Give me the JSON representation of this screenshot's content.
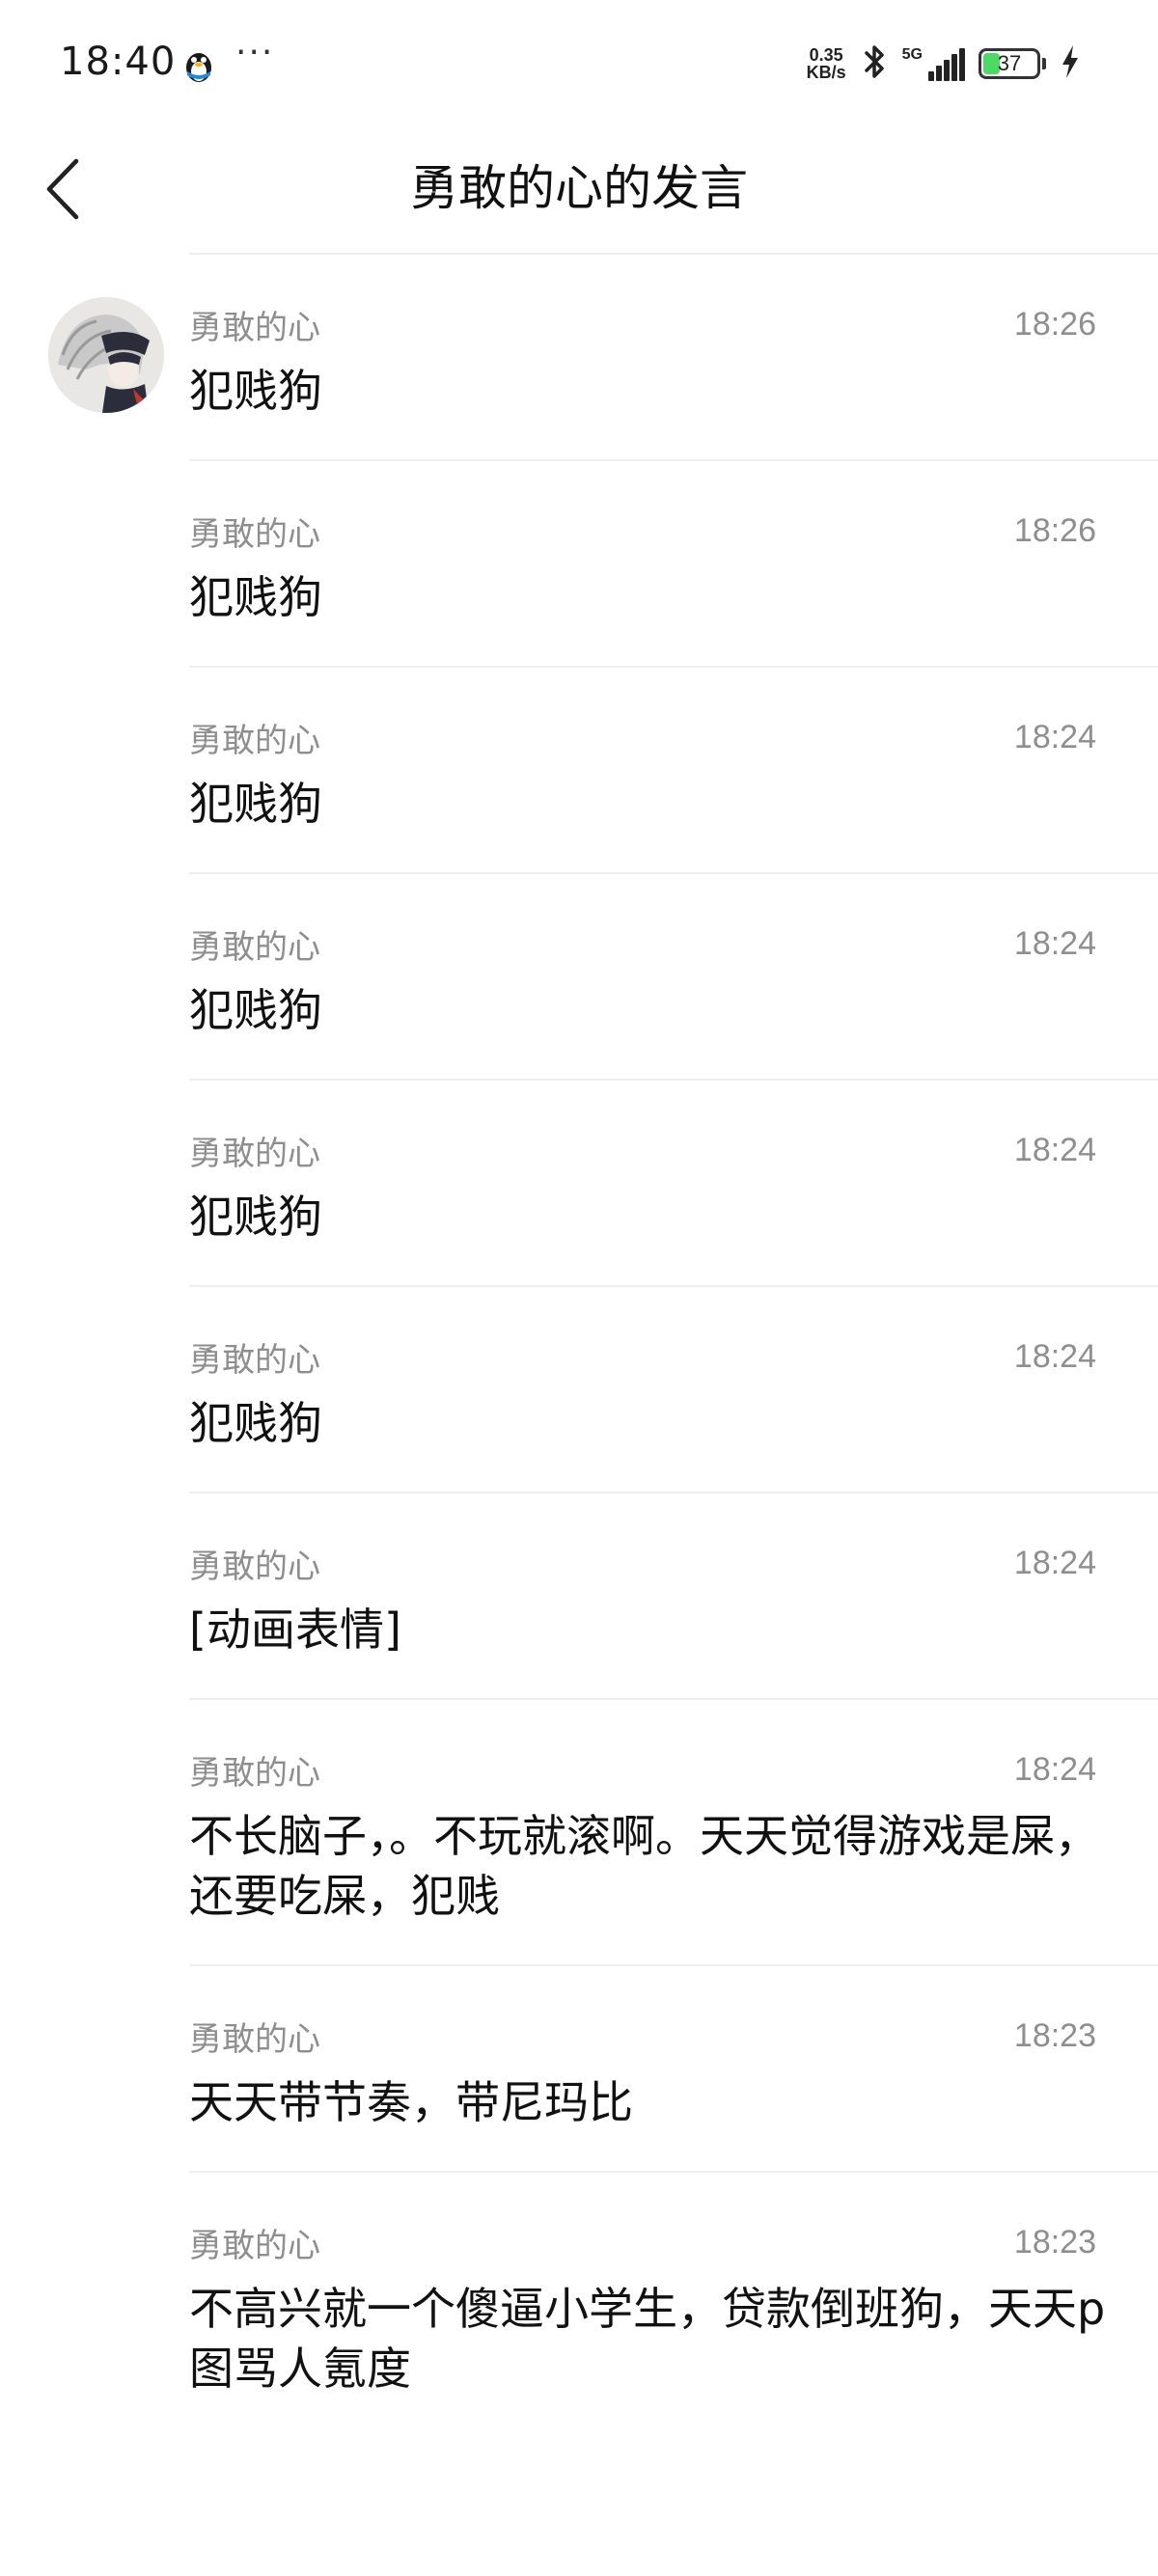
{
  "status_bar": {
    "time": "18:40",
    "dots": "···",
    "speed_value": "0.35",
    "speed_unit": "KB/s",
    "network": "5G",
    "battery": "37",
    "battery_level": 0.37
  },
  "header": {
    "title": "勇敢的心的发言"
  },
  "messages": [
    {
      "user": "勇敢的心",
      "time": "18:26",
      "text": "犯贱狗"
    },
    {
      "user": "勇敢的心",
      "time": "18:26",
      "text": "犯贱狗"
    },
    {
      "user": "勇敢的心",
      "time": "18:24",
      "text": "犯贱狗"
    },
    {
      "user": "勇敢的心",
      "time": "18:24",
      "text": "犯贱狗"
    },
    {
      "user": "勇敢的心",
      "time": "18:24",
      "text": "犯贱狗"
    },
    {
      "user": "勇敢的心",
      "time": "18:24",
      "text": "犯贱狗"
    },
    {
      "user": "勇敢的心",
      "time": "18:24",
      "text": "[动画表情]"
    },
    {
      "user": "勇敢的心",
      "time": "18:24",
      "text": "不长脑子，。不玩就滚啊。天天觉得游戏是屎，还要吃屎，犯贱"
    },
    {
      "user": "勇敢的心",
      "time": "18:23",
      "text": "天天带节奏，带尼玛比"
    },
    {
      "user": "勇敢的心",
      "time": "18:23",
      "text": "不高兴就一个傻逼小学生，贷款倒班狗，天天p图骂人氪度"
    }
  ]
}
